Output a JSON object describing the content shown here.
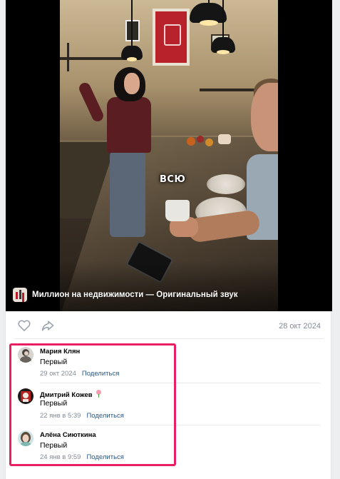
{
  "video": {
    "overlay_caption": "ВСЮ",
    "audio_label": "Миллион на недвижимости — Оригинальный звук"
  },
  "post": {
    "date": "28 окт 2024"
  },
  "colors": {
    "link": "#2a5885",
    "meta": "#818c99",
    "highlight": "#e91e63"
  },
  "comments": [
    {
      "author": "Мария Клян",
      "text": "Первый",
      "date": "29 окт 2024",
      "share_label": "Поделиться"
    },
    {
      "author": "Дмитрий Кожев",
      "text": "Первый",
      "date": "22 янв в 5:39",
      "share_label": "Поделиться"
    },
    {
      "author": "Алёна Сиюткина",
      "text": "Первый",
      "date": "24 янв в 9:59",
      "share_label": "Поделиться"
    }
  ]
}
